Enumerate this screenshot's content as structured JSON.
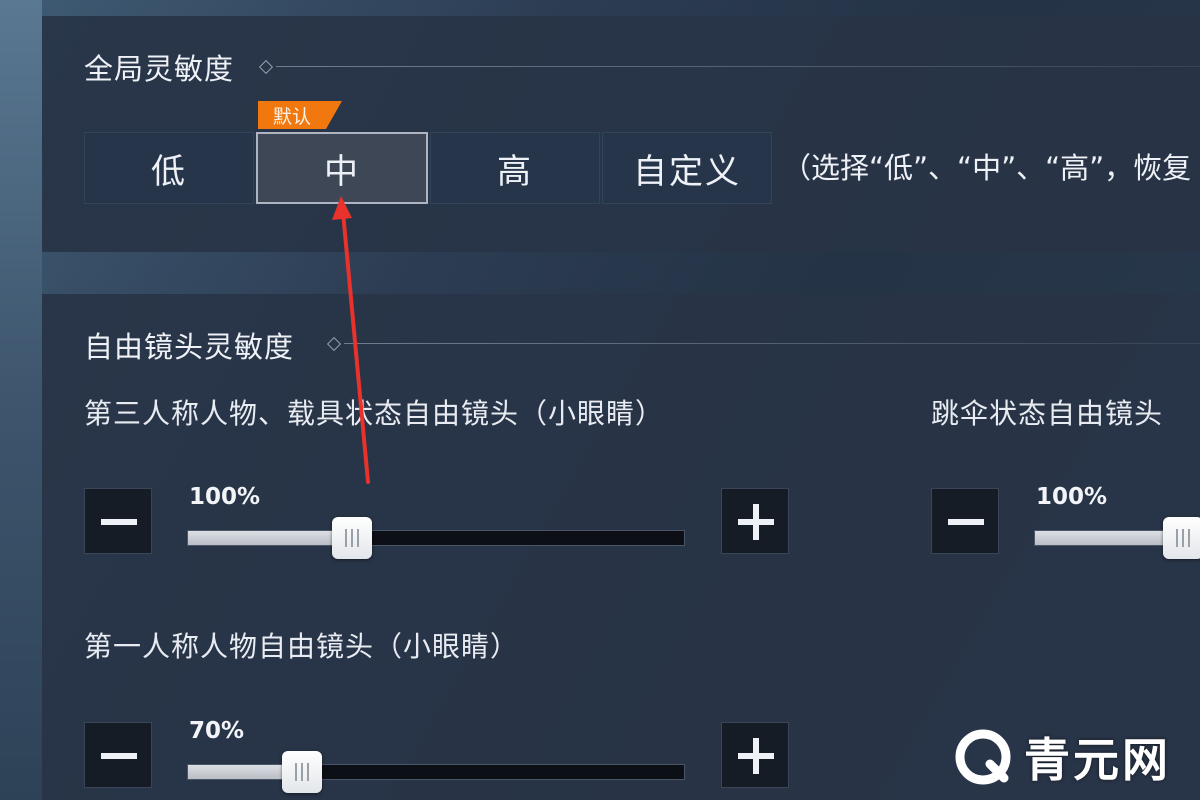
{
  "global_sensitivity": {
    "title": "全局灵敏度",
    "default_badge": "默认",
    "options": [
      {
        "label": "低",
        "selected": false
      },
      {
        "label": "中",
        "selected": true
      },
      {
        "label": "高",
        "selected": false
      },
      {
        "label": "自定义",
        "selected": false
      }
    ],
    "hint": "（选择“低”、“中”、“高”，恢复"
  },
  "free_camera": {
    "title": "自由镜头灵敏度",
    "third_person": {
      "label": "第三人称人物、载具状态自由镜头（小眼睛）",
      "value_text": "100%",
      "level": 0.33
    },
    "parachute": {
      "label": "跳伞状态自由镜头",
      "value_text": "100%",
      "level": 0.9
    },
    "first_person": {
      "label": "第一人称人物自由镜头（小眼睛）",
      "value_text": "70%",
      "level": 0.23
    }
  },
  "watermark": {
    "text": "青元网"
  },
  "colors": {
    "accent_orange": "#f1780f",
    "annotation_red": "#e8322b",
    "panel": "#283446",
    "selected_border": "#aeb5c0"
  },
  "icons": {
    "minus": "minus-icon",
    "plus": "plus-icon",
    "diamond": "diamond-icon",
    "watermark_logo": "q-logo-icon"
  }
}
